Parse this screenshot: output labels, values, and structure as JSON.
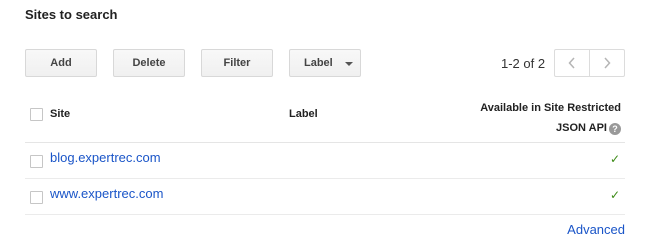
{
  "page": {
    "title": "Sites to search"
  },
  "toolbar": {
    "add_label": "Add",
    "delete_label": "Delete",
    "filter_label": "Filter",
    "label_label": "Label"
  },
  "pager": {
    "range_text": "1-2 of 2",
    "prev_icon": "chevron-left-icon",
    "next_icon": "chevron-right-icon"
  },
  "table": {
    "columns": {
      "site": "Site",
      "label": "Label",
      "available_line1": "Available in Site Restricted",
      "available_line2": "JSON API",
      "help_glyph": "?"
    },
    "rows": [
      {
        "site": "blog.expertrec.com",
        "label": "",
        "available": "✓"
      },
      {
        "site": "www.expertrec.com",
        "label": "",
        "available": "✓"
      }
    ]
  },
  "footer": {
    "advanced_label": "Advanced"
  },
  "colors": {
    "link": "#1a55c8",
    "check": "#3d8b17"
  }
}
